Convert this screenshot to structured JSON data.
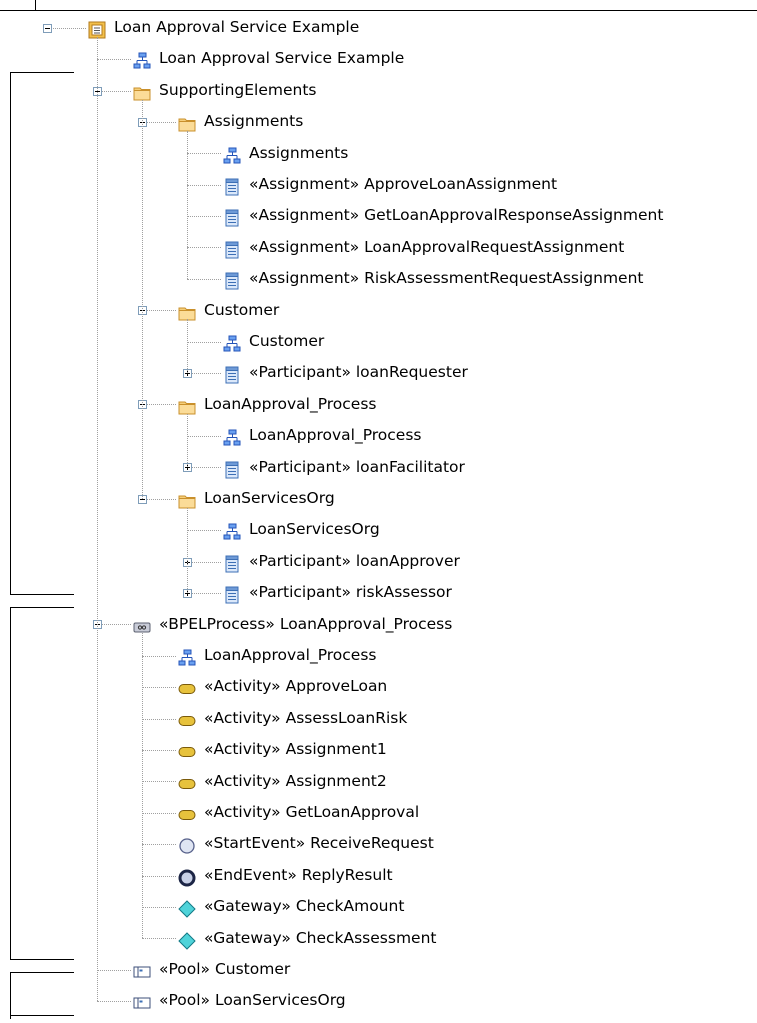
{
  "tree": {
    "items": [
      {
        "label": "Loan Approval Service Example",
        "icon": "model-icon",
        "toggle": "expanded"
      },
      {
        "label": "Loan Approval Service Example",
        "icon": "diagram-icon"
      },
      {
        "label": "SupportingElements",
        "icon": "folder-icon",
        "toggle": "expanded"
      },
      {
        "label": "Assignments",
        "icon": "folder-icon",
        "toggle": "expanded"
      },
      {
        "label": "Assignments",
        "icon": "diagram-icon"
      },
      {
        "label": "«Assignment» ApproveLoanAssignment",
        "icon": "class-icon"
      },
      {
        "label": "«Assignment» GetLoanApprovalResponseAssignment",
        "icon": "class-icon"
      },
      {
        "label": "«Assignment» LoanApprovalRequestAssignment",
        "icon": "class-icon"
      },
      {
        "label": "«Assignment» RiskAssessmentRequestAssignment",
        "icon": "class-icon"
      },
      {
        "label": "Customer",
        "icon": "folder-icon",
        "toggle": "expanded"
      },
      {
        "label": "Customer",
        "icon": "diagram-icon"
      },
      {
        "label": "«Participant» loanRequester",
        "icon": "class-icon",
        "toggle": "collapsed"
      },
      {
        "label": "LoanApproval_Process",
        "icon": "folder-icon",
        "toggle": "expanded"
      },
      {
        "label": "LoanApproval_Process",
        "icon": "diagram-icon"
      },
      {
        "label": "«Participant» loanFacilitator",
        "icon": "class-icon",
        "toggle": "collapsed"
      },
      {
        "label": "LoanServicesOrg",
        "icon": "folder-icon",
        "toggle": "expanded"
      },
      {
        "label": "LoanServicesOrg",
        "icon": "diagram-icon"
      },
      {
        "label": "«Participant» loanApprover",
        "icon": "class-icon",
        "toggle": "collapsed"
      },
      {
        "label": "«Participant» riskAssessor",
        "icon": "class-icon",
        "toggle": "collapsed"
      },
      {
        "label": "«BPELProcess» LoanApproval_Process",
        "icon": "process-icon",
        "toggle": "expanded"
      },
      {
        "label": "LoanApproval_Process",
        "icon": "diagram-icon"
      },
      {
        "label": "«Activity» ApproveLoan",
        "icon": "activity-icon"
      },
      {
        "label": "«Activity» AssessLoanRisk",
        "icon": "activity-icon"
      },
      {
        "label": "«Activity» Assignment1",
        "icon": "activity-icon"
      },
      {
        "label": "«Activity» Assignment2",
        "icon": "activity-icon"
      },
      {
        "label": "«Activity» GetLoanApproval",
        "icon": "activity-icon"
      },
      {
        "label": "«StartEvent» ReceiveRequest",
        "icon": "start-event-icon"
      },
      {
        "label": "«EndEvent» ReplyResult",
        "icon": "end-event-icon"
      },
      {
        "label": "«Gateway» CheckAmount",
        "icon": "gateway-icon"
      },
      {
        "label": "«Gateway» CheckAssessment",
        "icon": "gateway-icon"
      },
      {
        "label": "«Pool» Customer",
        "icon": "pool-icon"
      },
      {
        "label": "«Pool» LoanServicesOrg",
        "icon": "pool-icon"
      }
    ]
  }
}
